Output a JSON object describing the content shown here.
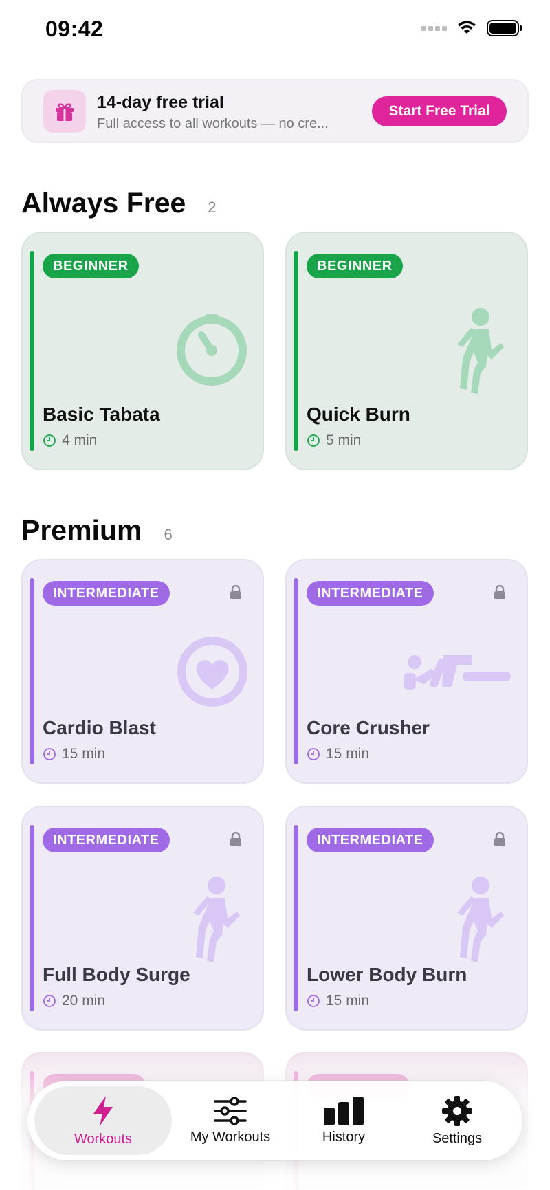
{
  "status_bar": {
    "time": "09:42"
  },
  "trial_banner": {
    "title": "14-day free trial",
    "subtitle": "Full access to all workouts — no cre...",
    "button_label": "Start Free Trial",
    "accent_color": "#e0249b"
  },
  "sections": {
    "free": {
      "title": "Always Free",
      "count": "2",
      "cards": [
        {
          "level": "BEGINNER",
          "title": "Basic Tabata",
          "duration": "4 min",
          "icon": "stopwatch-icon"
        },
        {
          "level": "BEGINNER",
          "title": "Quick Burn",
          "duration": "5 min",
          "icon": "running-person-icon"
        }
      ]
    },
    "premium": {
      "title": "Premium",
      "count": "6",
      "cards": [
        {
          "level": "INTERMEDIATE",
          "title": "Cardio Blast",
          "duration": "15 min",
          "icon": "heart-icon",
          "locked": true
        },
        {
          "level": "INTERMEDIATE",
          "title": "Core Crusher",
          "duration": "15 min",
          "icon": "plank-person-icon",
          "locked": true
        },
        {
          "level": "INTERMEDIATE",
          "title": "Full Body Surge",
          "duration": "20 min",
          "icon": "running-person-icon",
          "locked": true
        },
        {
          "level": "INTERMEDIATE",
          "title": "Lower Body Burn",
          "duration": "15 min",
          "icon": "running-person-icon",
          "locked": true
        }
      ]
    }
  },
  "tab_bar": {
    "tabs": [
      {
        "label": "Workouts",
        "icon": "bolt-icon",
        "active": true
      },
      {
        "label": "My Workouts",
        "icon": "sliders-icon",
        "active": false
      },
      {
        "label": "History",
        "icon": "bar-chart-icon",
        "active": false
      },
      {
        "label": "Settings",
        "icon": "gear-icon",
        "active": false
      }
    ]
  },
  "colors": {
    "free_accent": "#16a34a",
    "premium_accent": "#9b6ce6",
    "active_tab": "#d01f90"
  }
}
